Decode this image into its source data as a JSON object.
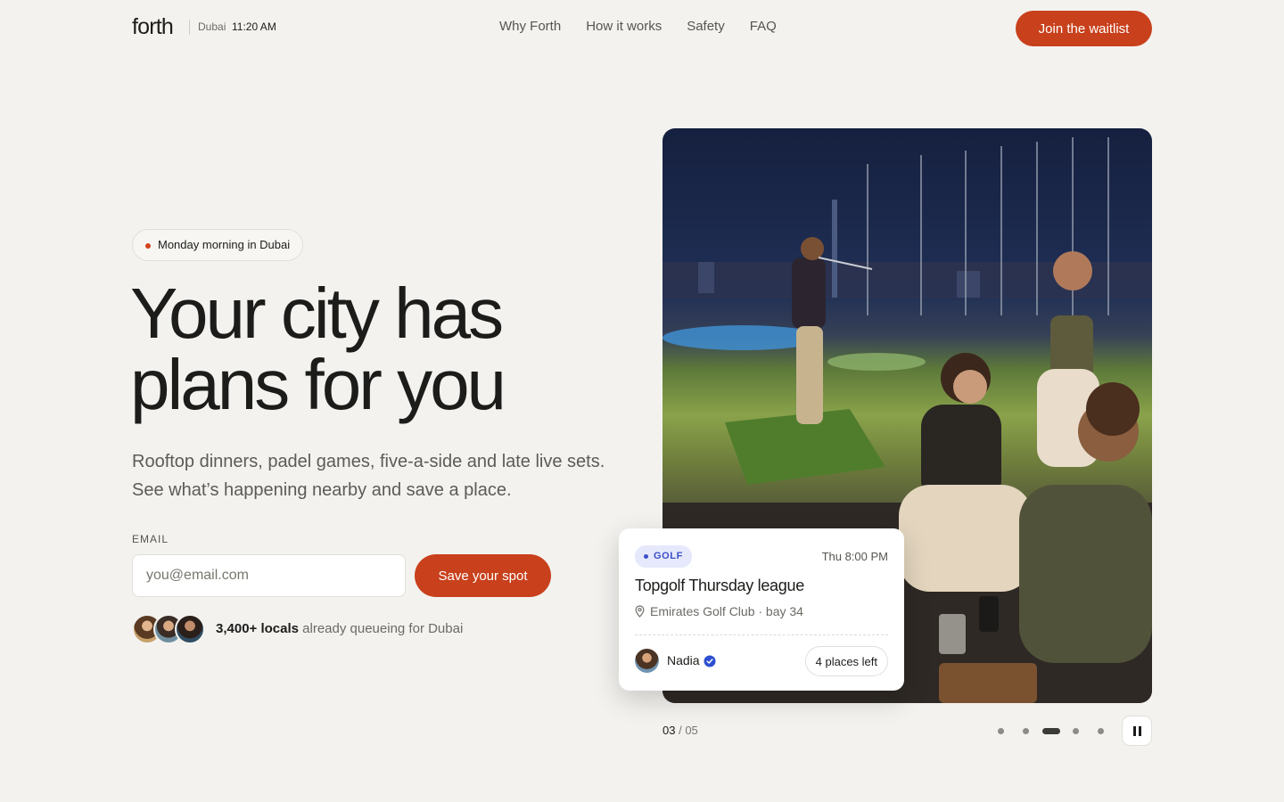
{
  "header": {
    "logo": "forth",
    "city": "Dubai",
    "time": "11:20 AM",
    "nav": [
      "Why Forth",
      "How it works",
      "Safety",
      "FAQ"
    ],
    "cta_label": "Join the waitlist"
  },
  "hero": {
    "badge": "Monday morning in Dubai",
    "headline": "Your city has plans for you",
    "subhead": "Rooftop dinners, padel games, five-a-side and late live sets. See what’s happening nearby and save a place.",
    "email_label": "EMAIL",
    "email_placeholder": "you@email.com",
    "submit_label": "Save your spot",
    "social_count": "3,400+ locals",
    "social_text": " already queueing for Dubai"
  },
  "event_card": {
    "category": "GOLF",
    "time": "Thu 8:00 PM",
    "title": "Topgolf Thursday league",
    "location": "Emirates Golf Club · bay 34",
    "host": "Nadia",
    "places": "4 places left"
  },
  "slider": {
    "current": "03",
    "total": "/ 05",
    "active_index": 2,
    "dot_count": 5
  },
  "colors": {
    "accent": "#c8401c",
    "background": "#f3f2ef",
    "tag": "#3a4fc8"
  },
  "icons": {
    "location": "pin-icon",
    "verified": "verified-check-icon",
    "pause": "pause-icon"
  }
}
